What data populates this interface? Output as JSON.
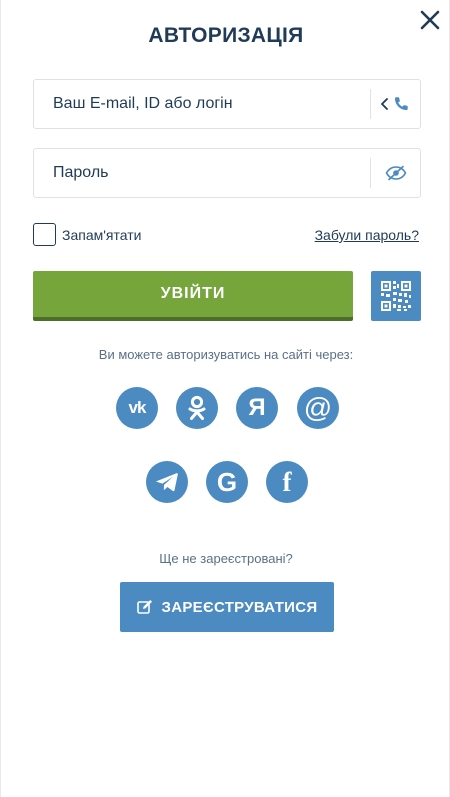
{
  "dialog": {
    "title": "АВТОРИЗАЦІЯ",
    "close_icon": "close-icon"
  },
  "login_field": {
    "placeholder": "Ваш E-mail, ID або логін",
    "value": "",
    "suffix_icons": [
      "chevron-left-icon",
      "phone-icon"
    ]
  },
  "password_field": {
    "placeholder": "Пароль",
    "value": "",
    "suffix_icon": "eye-slash-icon"
  },
  "remember": {
    "label": "Запам'ятати",
    "checked": false
  },
  "forgot_link": "Забули пароль?",
  "login_button": {
    "label": "УВІЙТИ",
    "color": "#76a53c"
  },
  "qr_button": {
    "icon": "qr-code-icon",
    "color": "#4c8ac2"
  },
  "social": {
    "prompt": "Ви можете авторизуватись на сайті через:",
    "providers": [
      {
        "name": "vk",
        "glyph": "vk"
      },
      {
        "name": "odnoklassniki",
        "glyph": "ok-icon"
      },
      {
        "name": "yandex",
        "glyph": "Я"
      },
      {
        "name": "mail",
        "glyph": "@"
      },
      {
        "name": "telegram",
        "glyph": "telegram-icon"
      },
      {
        "name": "google",
        "glyph": "G"
      },
      {
        "name": "facebook",
        "glyph": "f"
      }
    ],
    "color": "#4c8ac2"
  },
  "register": {
    "prompt": "Ще не зареєстровані?",
    "button_label": "ЗАРЕЄСТРУВАТИСЯ",
    "icon": "edit-icon"
  }
}
